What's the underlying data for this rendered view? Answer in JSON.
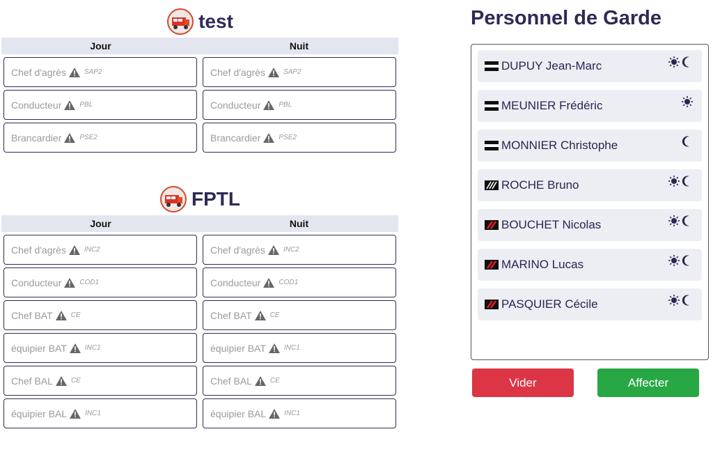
{
  "vehicles": [
    {
      "name": "test",
      "icon": "fire-truck-icon",
      "columns": [
        "Jour",
        "Nuit"
      ],
      "slots": [
        {
          "role": "Chef d'agrès",
          "qual": "SAP2"
        },
        {
          "role": "Conducteur",
          "qual": "PBL"
        },
        {
          "role": "Brancardier",
          "qual": "PSE2"
        }
      ]
    },
    {
      "name": "FPTL",
      "icon": "fire-truck-icon",
      "columns": [
        "Jour",
        "Nuit"
      ],
      "slots": [
        {
          "role": "Chef d'agrès",
          "qual": "INC2"
        },
        {
          "role": "Conducteur",
          "qual": "COD1"
        },
        {
          "role": "Chef BAT",
          "qual": "CE"
        },
        {
          "role": "équipier BAT",
          "qual": "INC1"
        },
        {
          "role": "Chef BAL",
          "qual": "CE"
        },
        {
          "role": "équipier BAL",
          "qual": "INC1"
        }
      ]
    }
  ],
  "garde": {
    "title": "Personnel de Garde",
    "personnel": [
      {
        "name": "DUPUY Jean-Marc",
        "grade": "officer-bar",
        "day": true,
        "night": true
      },
      {
        "name": "MEUNIER Frédéric",
        "grade": "officer-bar",
        "day": true,
        "night": false
      },
      {
        "name": "MONNIER Christophe",
        "grade": "officer-bar",
        "day": false,
        "night": true
      },
      {
        "name": "ROCHE Bruno",
        "grade": "chevrons-white",
        "day": true,
        "night": true
      },
      {
        "name": "BOUCHET Nicolas",
        "grade": "chevrons-red",
        "day": true,
        "night": true
      },
      {
        "name": "MARINO Lucas",
        "grade": "chevrons-red",
        "day": true,
        "night": true
      },
      {
        "name": "PASQUIER Cécile",
        "grade": "chevrons-red",
        "day": true,
        "night": true
      }
    ]
  },
  "buttons": {
    "vider": "Vider",
    "affecter": "Affecter"
  },
  "colors": {
    "primary": "#2e2a55",
    "danger": "#dc3545",
    "success": "#28a745",
    "header_bg": "#e4e6ef"
  }
}
